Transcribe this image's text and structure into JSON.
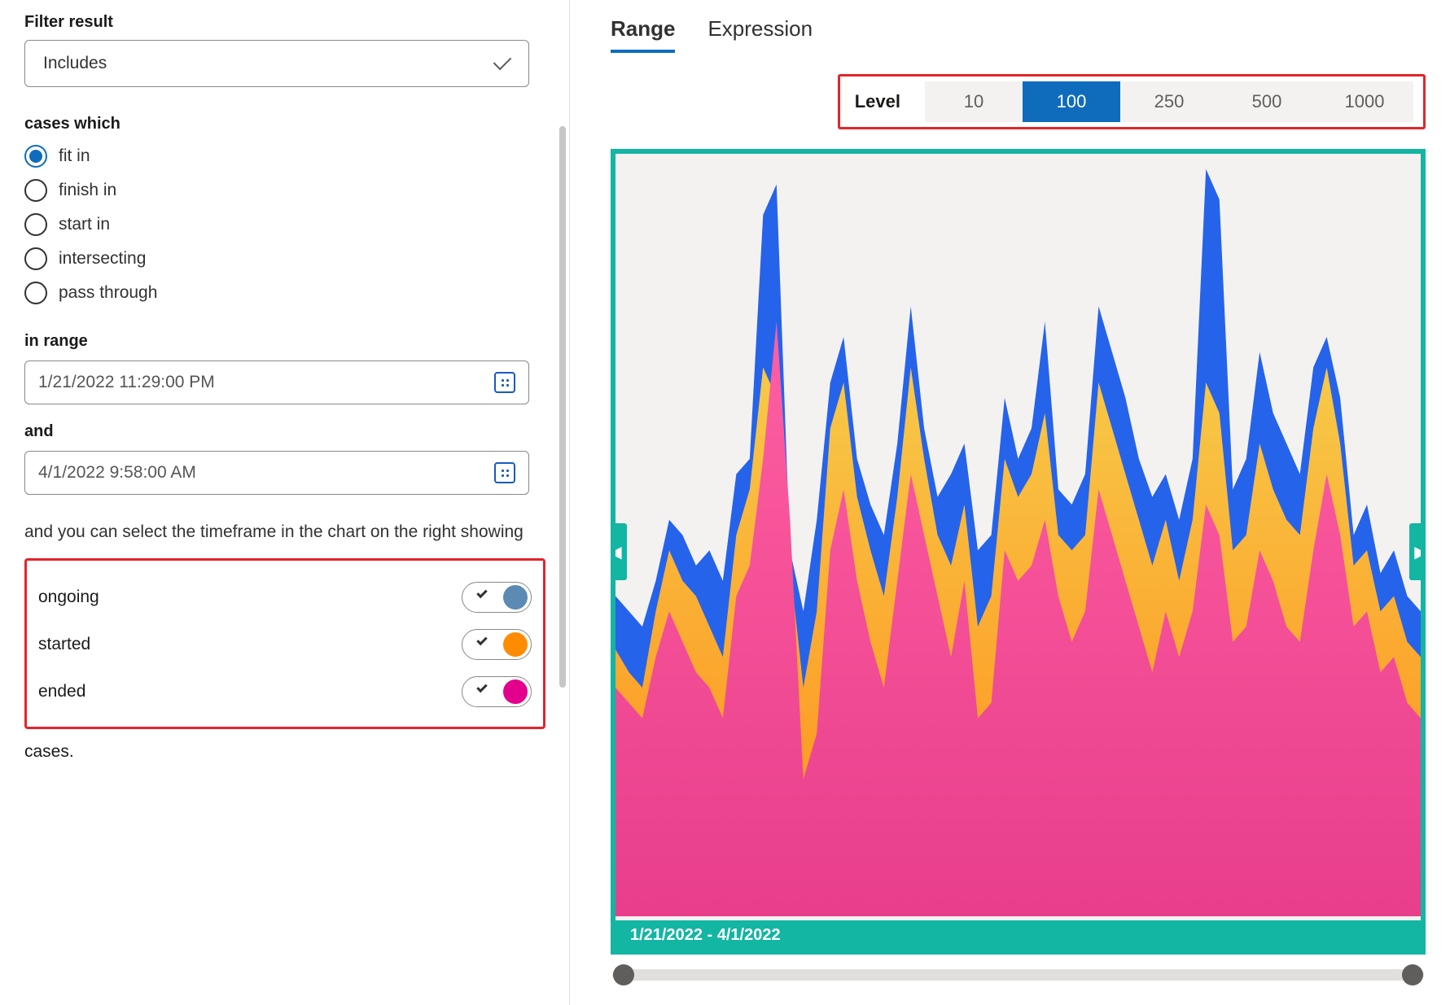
{
  "left": {
    "filter_result_title": "Filter result",
    "filter_select_value": "Includes",
    "cases_which_title": "cases which",
    "radios": [
      {
        "label": "fit in",
        "selected": true
      },
      {
        "label": "finish in",
        "selected": false
      },
      {
        "label": "start in",
        "selected": false
      },
      {
        "label": "intersecting",
        "selected": false
      },
      {
        "label": "pass through",
        "selected": false
      }
    ],
    "in_range_label": "in range",
    "date_start": "1/21/2022 11:29:00 PM",
    "and_label": "and",
    "date_end": "4/1/2022 9:58:00 AM",
    "timeframe_paragraph": "and you can select the timeframe in the chart on the right showing",
    "toggles": [
      {
        "label": "ongoing",
        "color": "#5b8bb2",
        "on": true
      },
      {
        "label": "started",
        "color": "#ff8c00",
        "on": true
      },
      {
        "label": "ended",
        "color": "#e3008c",
        "on": true
      }
    ],
    "cases_suffix": "cases."
  },
  "right": {
    "tabs": [
      {
        "label": "Range",
        "active": true
      },
      {
        "label": "Expression",
        "active": false
      }
    ],
    "level_label": "Level",
    "level_options": [
      {
        "label": "10",
        "active": false
      },
      {
        "label": "100",
        "active": true
      },
      {
        "label": "250",
        "active": false
      },
      {
        "label": "500",
        "active": false
      },
      {
        "label": "1000",
        "active": false
      }
    ],
    "chart_range_caption": "1/21/2022 - 4/1/2022"
  },
  "chart_data": {
    "type": "area",
    "xlabel": "",
    "ylabel": "",
    "x_range_start": "1/21/2022",
    "x_range_end": "4/1/2022",
    "ylim": [
      0,
      100
    ],
    "series": [
      {
        "name": "ongoing",
        "color": "#2563eb",
        "values": [
          42,
          40,
          38,
          44,
          52,
          50,
          46,
          48,
          44,
          58,
          60,
          92,
          96,
          48,
          40,
          52,
          70,
          76,
          60,
          54,
          50,
          62,
          80,
          64,
          55,
          58,
          62,
          48,
          50,
          68,
          60,
          64,
          78,
          56,
          54,
          58,
          80,
          74,
          68,
          60,
          55,
          58,
          52,
          60,
          98,
          94,
          56,
          60,
          74,
          66,
          62,
          58,
          72,
          76,
          68,
          50,
          54,
          45,
          48,
          42,
          40
        ]
      },
      {
        "name": "started",
        "color_top": "#f7b500",
        "color_bottom": "#ff8c1a",
        "values": [
          35,
          32,
          30,
          40,
          48,
          44,
          42,
          38,
          34,
          50,
          56,
          72,
          68,
          46,
          30,
          40,
          64,
          70,
          55,
          48,
          42,
          55,
          72,
          60,
          50,
          46,
          54,
          38,
          42,
          60,
          55,
          58,
          66,
          50,
          48,
          50,
          70,
          64,
          58,
          52,
          46,
          52,
          44,
          52,
          70,
          66,
          48,
          50,
          62,
          56,
          52,
          50,
          64,
          72,
          62,
          46,
          48,
          40,
          42,
          36,
          34
        ]
      },
      {
        "name": "ended",
        "color": "#e83e8c",
        "values": [
          30,
          28,
          26,
          34,
          40,
          36,
          32,
          30,
          26,
          42,
          46,
          60,
          78,
          52,
          18,
          24,
          48,
          56,
          44,
          36,
          30,
          44,
          58,
          50,
          42,
          34,
          44,
          26,
          28,
          48,
          44,
          46,
          52,
          42,
          36,
          40,
          56,
          50,
          44,
          38,
          32,
          40,
          34,
          40,
          54,
          50,
          36,
          38,
          48,
          44,
          38,
          36,
          48,
          58,
          50,
          38,
          40,
          32,
          34,
          28,
          26
        ]
      }
    ]
  }
}
